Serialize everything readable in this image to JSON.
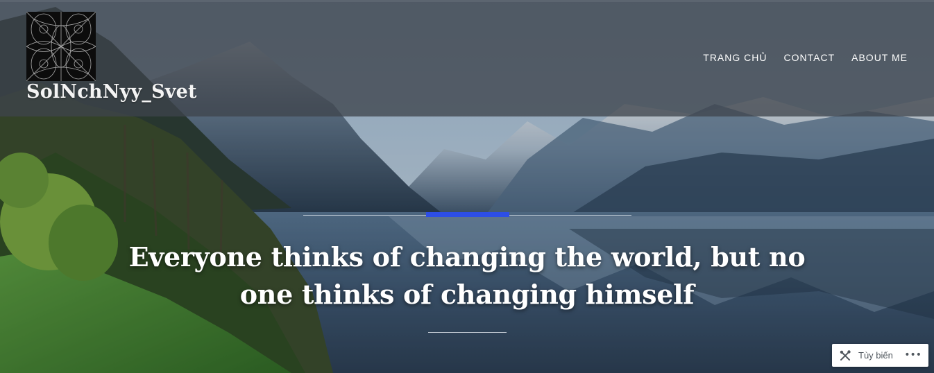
{
  "site": {
    "title": "SolNchNyy_Svet"
  },
  "nav": {
    "items": [
      "Trang chủ",
      "Contact",
      "About me"
    ]
  },
  "hero": {
    "quote": "Everyone thinks of changing the world, but no one thinks of changing himself",
    "accent_color": "#2d4ee6"
  },
  "customize": {
    "label": "Tùy biến",
    "icon": "tools-icon",
    "more_icon": "more-horizontal-icon"
  },
  "icons": {
    "logo": "site-logo-pattern",
    "customize": "tools-icon",
    "more": "more-horizontal-icon"
  },
  "colors": {
    "header_overlay": "#3c424a",
    "accent": "#2d4ee6",
    "text": "#ffffff"
  }
}
